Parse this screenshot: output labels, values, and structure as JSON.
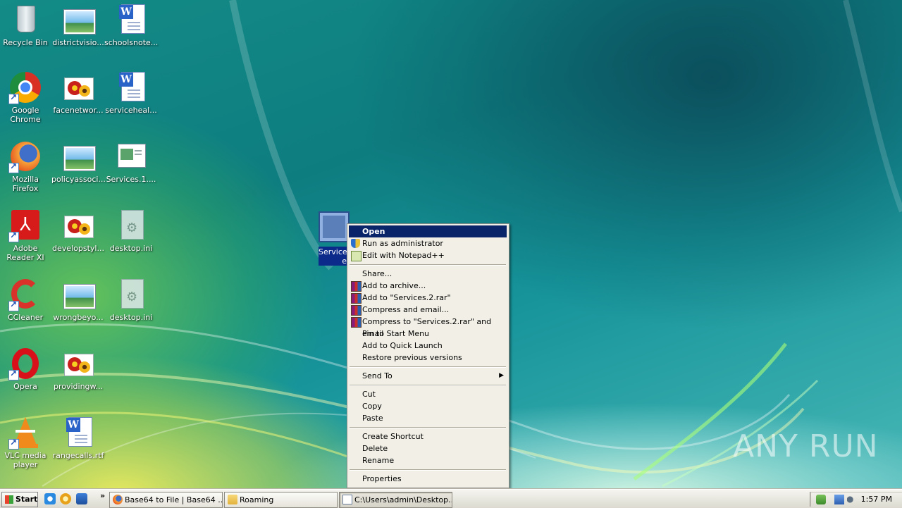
{
  "desktop": {
    "icons": [
      {
        "label": "Recycle Bin",
        "icon": "recycle-bin-icon"
      },
      {
        "label": "districtvisio...",
        "icon": "image-file-icon"
      },
      {
        "label": "schoolsnote...",
        "icon": "word-document-icon"
      },
      {
        "label": "Google Chrome",
        "icon": "chrome-icon"
      },
      {
        "label": "facenetwor...",
        "icon": "image-file-icon"
      },
      {
        "label": "serviceheal...",
        "icon": "word-document-icon"
      },
      {
        "label": "Mozilla Firefox",
        "icon": "firefox-icon"
      },
      {
        "label": "policyassoci...",
        "icon": "image-file-icon"
      },
      {
        "label": "Services.1....",
        "icon": "window-file-icon"
      },
      {
        "label": "Adobe Reader XI",
        "icon": "adobe-reader-icon"
      },
      {
        "label": "developstyl...",
        "icon": "image-file-icon"
      },
      {
        "label": "desktop.ini",
        "icon": "ini-file-icon"
      },
      {
        "label": "CCleaner",
        "icon": "ccleaner-icon"
      },
      {
        "label": "wrongbeyo...",
        "icon": "image-file-icon"
      },
      {
        "label": "desktop.ini",
        "icon": "ini-file-icon"
      },
      {
        "label": "Opera",
        "icon": "opera-icon"
      },
      {
        "label": "providingw...",
        "icon": "image-file-icon"
      },
      {
        "label": "VLC media player",
        "icon": "vlc-icon"
      },
      {
        "label": "rangecalls.rtf",
        "icon": "word-document-icon"
      }
    ],
    "selected_icon": {
      "label": "Services",
      "suffix": "e"
    }
  },
  "context_menu": {
    "items": [
      {
        "label": "Open",
        "highlighted": true
      },
      {
        "label": "Run as administrator",
        "icon": "uac-shield-icon"
      },
      {
        "label": "Edit with Notepad++",
        "icon": "notepadpp-icon"
      },
      {
        "label": "Share..."
      },
      {
        "label": "Add to archive...",
        "icon": "winrar-icon"
      },
      {
        "label": "Add to \"Services.2.rar\"",
        "icon": "winrar-icon"
      },
      {
        "label": "Compress and email...",
        "icon": "winrar-icon"
      },
      {
        "label": "Compress to \"Services.2.rar\" and email",
        "icon": "winrar-icon"
      },
      {
        "label": "Pin to Start Menu"
      },
      {
        "label": "Add to Quick Launch"
      },
      {
        "label": "Restore previous versions"
      },
      {
        "label": "Send To",
        "submenu": true
      },
      {
        "label": "Cut"
      },
      {
        "label": "Copy"
      },
      {
        "label": "Paste"
      },
      {
        "label": "Create Shortcut"
      },
      {
        "label": "Delete"
      },
      {
        "label": "Rename"
      },
      {
        "label": "Properties"
      }
    ]
  },
  "watermark": "ANY RUN",
  "taskbar": {
    "start_label": "Start",
    "overflow": "»",
    "buttons": [
      {
        "label": "Base64 to File | Base64 ...",
        "icon": "firefox-icon"
      },
      {
        "label": "Roaming",
        "icon": "folder-icon"
      },
      {
        "label": "C:\\Users\\admin\\Desktop...",
        "icon": "notepad-icon"
      }
    ],
    "clock": "1:57 PM"
  },
  "colors": {
    "menu_highlight": "#0a246a",
    "menu_background": "#f1efe6",
    "taskbar": "#e5e3da"
  }
}
